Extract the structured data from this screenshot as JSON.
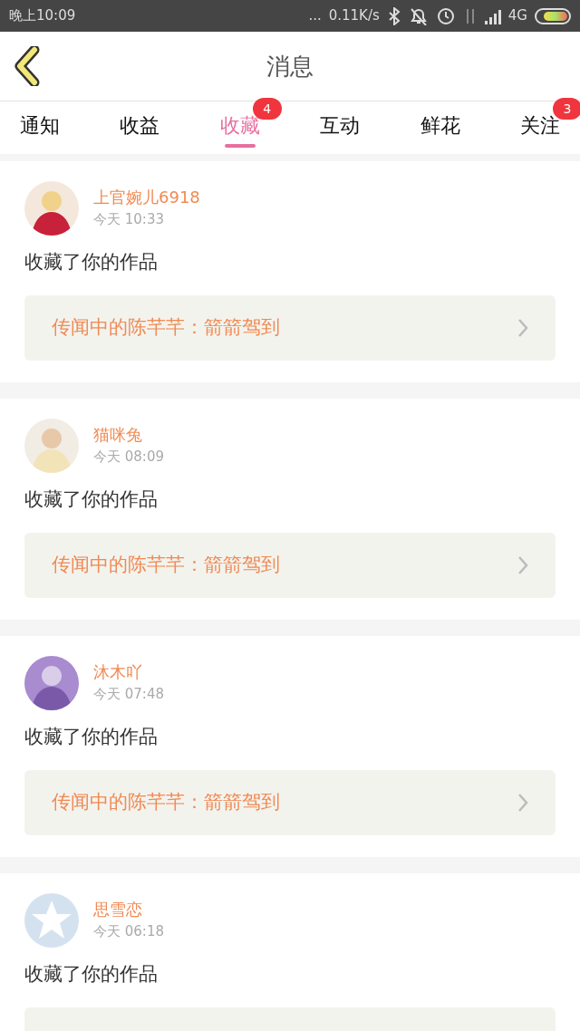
{
  "status_bar": {
    "time": "晚上10:09",
    "dots": "...",
    "speed": "0.11K/s",
    "network": "4G"
  },
  "header": {
    "title": "消息"
  },
  "tabs": [
    {
      "label": "通知",
      "selected": false
    },
    {
      "label": "收益",
      "selected": false
    },
    {
      "label": "收藏",
      "selected": true,
      "badge": "4"
    },
    {
      "label": "互动",
      "selected": false
    },
    {
      "label": "鲜花",
      "selected": false
    },
    {
      "label": "关注",
      "selected": false,
      "badge": "3"
    }
  ],
  "messages": [
    {
      "kind": "picture",
      "user": "上官婉儿6918",
      "time": "今天 10:33",
      "text": "收藏了你的作品",
      "work": "传闻中的陈芊芊：箭箭驾到"
    },
    {
      "kind": "picture",
      "user": "猫咪兔",
      "time": "今天 08:09",
      "text": "收藏了你的作品",
      "work": "传闻中的陈芊芊：箭箭驾到"
    },
    {
      "kind": "picture",
      "user": "沐木吖",
      "time": "今天 07:48",
      "text": "收藏了你的作品",
      "work": "传闻中的陈芊芊：箭箭驾到"
    },
    {
      "kind": "default",
      "user": "思雪恋",
      "time": "今天 06:18",
      "text": "收藏了你的作品"
    }
  ]
}
